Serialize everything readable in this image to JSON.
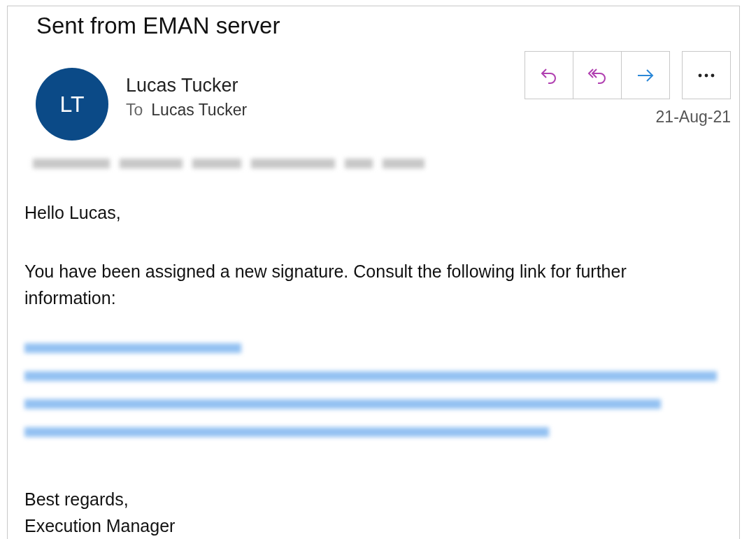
{
  "email": {
    "subject": "Sent from EMAN server",
    "sender": {
      "initials": "LT",
      "name": "Lucas Tucker"
    },
    "recipient": {
      "label": "To",
      "name": "Lucas Tucker"
    },
    "date": "21-Aug-21",
    "actions": [
      {
        "kind": "reply"
      },
      {
        "kind": "reply-all"
      },
      {
        "kind": "forward"
      }
    ],
    "body": {
      "greeting": "Hello Lucas,",
      "paragraph": "You have been assigned a new signature. Consult the following link for further information:",
      "closing": "Best regards,",
      "signature": "Execution Manager"
    }
  }
}
